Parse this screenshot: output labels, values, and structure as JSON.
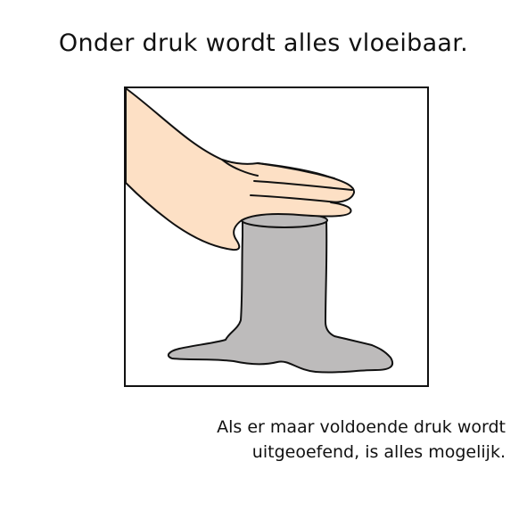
{
  "title": "Onder druk wordt alles vloeibaar.",
  "caption": {
    "line1": "Als er maar voldoende druk wordt",
    "line2": "uitgeoefend, is alles mogelijk."
  },
  "colors": {
    "frame": "#111111",
    "skin": "#fde0c5",
    "puddle": "#bdbbbb",
    "background": "#ffffff"
  },
  "illustration": {
    "icon": "hand-pressing-melting-cylinder"
  }
}
